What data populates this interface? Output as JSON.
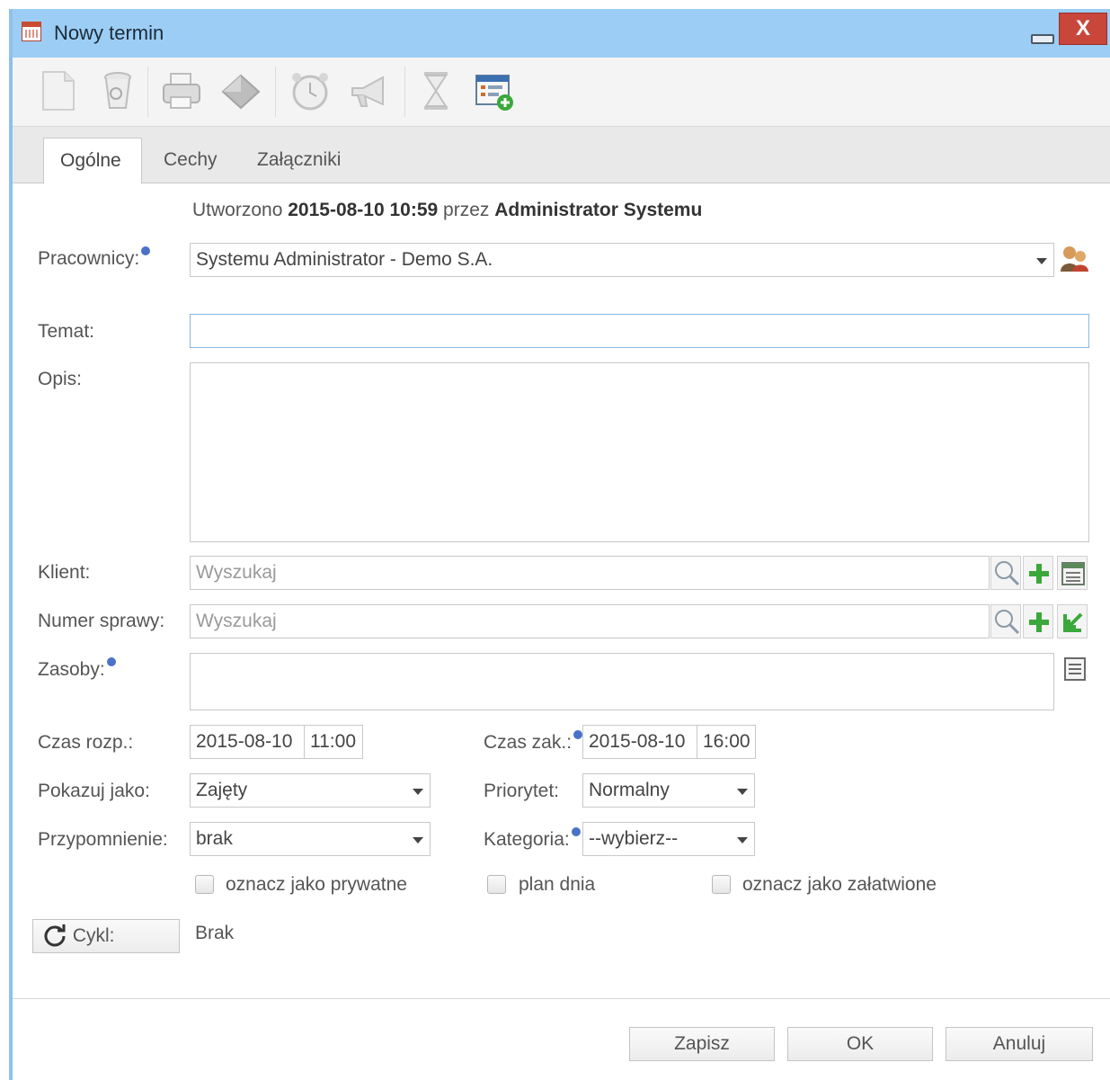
{
  "window": {
    "title": "Nowy termin",
    "close_label": "X"
  },
  "toolbar": {
    "icons": [
      "new-document-icon",
      "delete-icon",
      "print-icon",
      "export-icon",
      "alarm-clock-icon",
      "announce-icon",
      "hourglass-icon",
      "add-to-list-icon"
    ]
  },
  "tabs": [
    {
      "label": "Ogólne",
      "active": true
    },
    {
      "label": "Cechy",
      "active": false
    },
    {
      "label": "Załączniki",
      "active": false
    }
  ],
  "created": {
    "prefix": "Utworzono",
    "datetime": "2015-08-10 10:59",
    "by_label": "przez",
    "author": "Administrator Systemu"
  },
  "fields": {
    "employees_label": "Pracownicy:",
    "employees_value": "Systemu Administrator - Demo S.A.",
    "subject_label": "Temat:",
    "subject_value": "",
    "description_label": "Opis:",
    "description_value": "",
    "client_label": "Klient:",
    "client_placeholder": "Wyszukaj",
    "case_label": "Numer sprawy:",
    "case_placeholder": "Wyszukaj",
    "resources_label": "Zasoby:",
    "start_label": "Czas rozp.:",
    "start_date": "2015-08-10",
    "start_time": "11:00",
    "end_label": "Czas zak.:",
    "end_date": "2015-08-10",
    "end_time": "16:00",
    "show_as_label": "Pokazuj jako:",
    "show_as_value": "Zajęty",
    "priority_label": "Priorytet:",
    "priority_value": "Normalny",
    "reminder_label": "Przypomnienie:",
    "reminder_value": "brak",
    "category_label": "Kategoria:",
    "category_value": "--wybierz--"
  },
  "checkboxes": {
    "private_label": "oznacz jako prywatne",
    "day_plan_label": "plan dnia",
    "done_label": "oznacz jako załatwione"
  },
  "cycle": {
    "button_label": "Cykl:",
    "value": "Brak"
  },
  "footer": {
    "save_label": "Zapisz",
    "ok_label": "OK",
    "cancel_label": "Anuluj"
  },
  "colors": {
    "titlebar": "#9ccdf4",
    "close": "#c9463b",
    "add_green": "#3aa83a",
    "focus_border": "#8ab7e0"
  }
}
